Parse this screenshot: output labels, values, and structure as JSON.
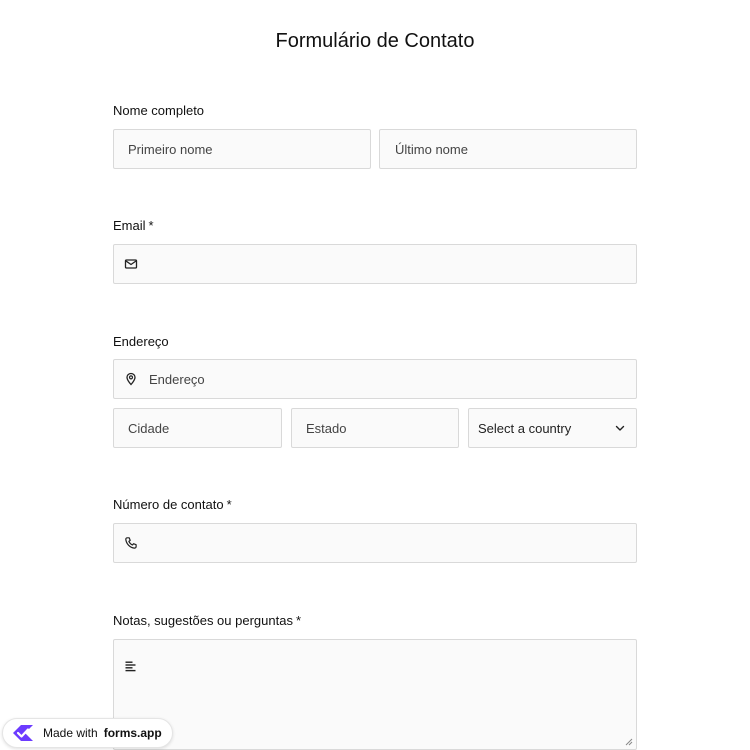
{
  "form": {
    "title": "Formulário de Contato"
  },
  "full_name": {
    "label": "Nome completo",
    "first_placeholder": "Primeiro nome",
    "last_placeholder": "Último nome"
  },
  "email": {
    "label": "Email",
    "required_mark": "*",
    "icon": "mail-icon"
  },
  "address": {
    "label": "Endereço",
    "street_placeholder": "Endereço",
    "street_icon": "location-pin-icon",
    "city_placeholder": "Cidade",
    "state_placeholder": "Estado",
    "country_selected": "Select a country"
  },
  "phone": {
    "label": "Número de contato",
    "required_mark": "*",
    "icon": "phone-icon"
  },
  "notes": {
    "label": "Notas, sugestões ou perguntas",
    "required_mark": "*",
    "icon": "text-align-icon"
  },
  "badge": {
    "prefix": "Made with",
    "brand": "forms.app",
    "logo_color": "#6c3bff"
  }
}
